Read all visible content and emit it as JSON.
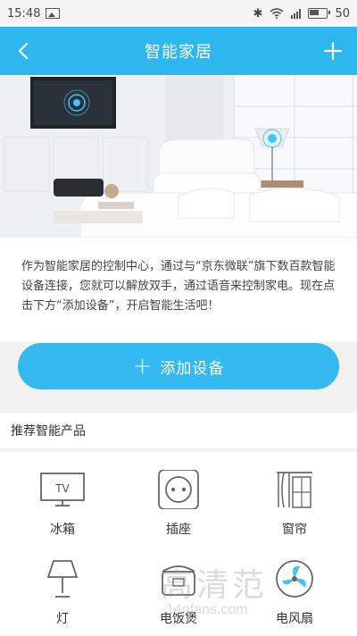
{
  "status": {
    "time": "15:48",
    "battery": "50"
  },
  "header": {
    "title": "智能家居"
  },
  "intro": {
    "text": "作为智能家居的控制中心，通过与“京东微联”旗下数百款智能设备连接，您就可以解放双手，通过语音来控制家电。现在点击下方“添加设备”，开启智能生活吧！"
  },
  "add_button": {
    "label": "添加设备"
  },
  "section": {
    "title": "推荐智能产品"
  },
  "products": [
    {
      "label": "冰箱",
      "icon": "tv-icon",
      "icon_text": "TV"
    },
    {
      "label": "插座",
      "icon": "socket-icon"
    },
    {
      "label": "窗帘",
      "icon": "curtain-icon"
    },
    {
      "label": "灯",
      "icon": "lamp-icon"
    },
    {
      "label": "电饭煲",
      "icon": "rice-cooker-icon"
    },
    {
      "label": "电风扇",
      "icon": "fan-icon"
    }
  ],
  "watermark": {
    "text": "高清范",
    "sub": "14pfans.com"
  },
  "colors": {
    "primary": "#2cb8ef",
    "button": "#35b9f1"
  }
}
